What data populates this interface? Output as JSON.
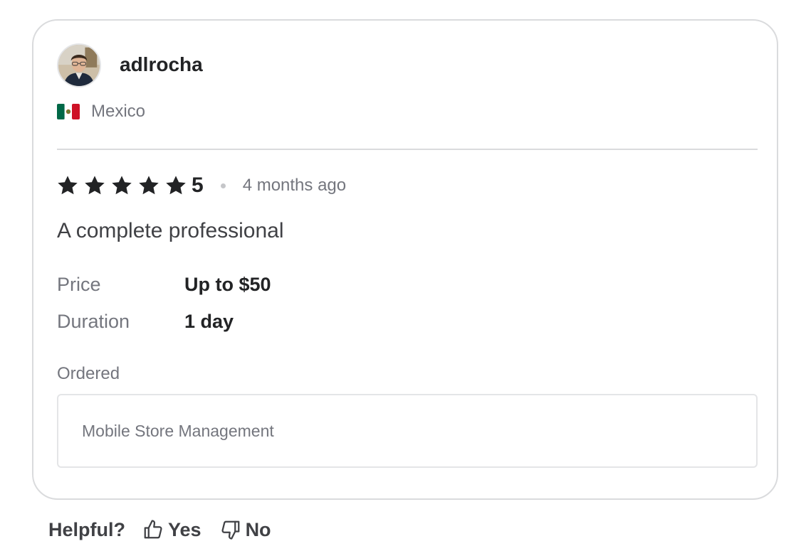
{
  "review": {
    "username": "adlrocha",
    "country": "Mexico",
    "flag_icon": "mexico-flag-icon",
    "rating": 5,
    "rating_label": "5",
    "star_color": "#222325",
    "time_ago": "4 months ago",
    "text": "A complete professional",
    "details": [
      {
        "label": "Price",
        "value": "Up to $50"
      },
      {
        "label": "Duration",
        "value": "1 day"
      }
    ],
    "ordered_label": "Ordered",
    "ordered_item": "Mobile Store Management"
  },
  "helpful": {
    "label": "Helpful?",
    "yes_label": "Yes",
    "yes_icon": "thumbs-up-icon",
    "no_label": "No",
    "no_icon": "thumbs-down-icon"
  }
}
